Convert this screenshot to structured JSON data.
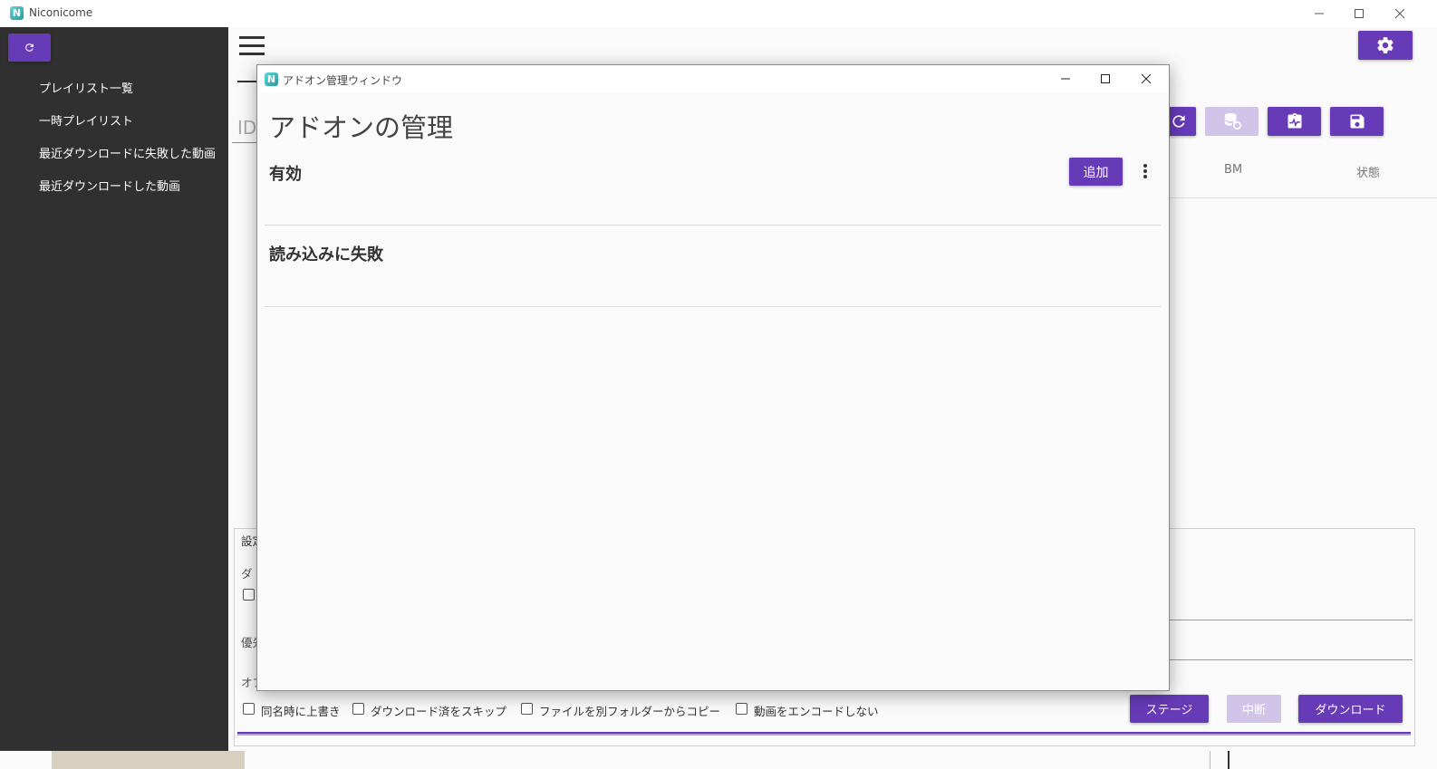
{
  "window": {
    "title": "Niconicome",
    "icon_letter": "N"
  },
  "sidebar": {
    "items": [
      {
        "label": "プレイリスト一覧"
      },
      {
        "label": "一時プレイリスト"
      },
      {
        "label": "最近ダウンロードに失敗した動画"
      },
      {
        "label": "最近ダウンロードした動画"
      }
    ]
  },
  "main": {
    "search_placeholder": "ID",
    "columns": [
      "BM",
      "状態"
    ],
    "settings_partial": [
      "設定",
      "ダ",
      "優先",
      "オプ"
    ],
    "options": [
      {
        "label": "同名時に上書き",
        "checked": false
      },
      {
        "label": "ダウンロード済をスキップ",
        "checked": false
      },
      {
        "label": "ファイルを別フォルダーからコピー",
        "checked": false
      },
      {
        "label": "動画をエンコードしない",
        "checked": false
      }
    ],
    "buttons": {
      "stage": "ステージ",
      "abort": "中断",
      "download": "ダウンロード"
    }
  },
  "dialog": {
    "title": "アドオン管理ウィンドウ",
    "heading": "アドオンの管理",
    "enabled_section": "有効",
    "add_button": "追加",
    "failed_section": "読み込みに失敗"
  },
  "colors": {
    "accent": "#673ab7",
    "accent_disabled": "#d1c4e9",
    "sidebar": "#303030"
  }
}
